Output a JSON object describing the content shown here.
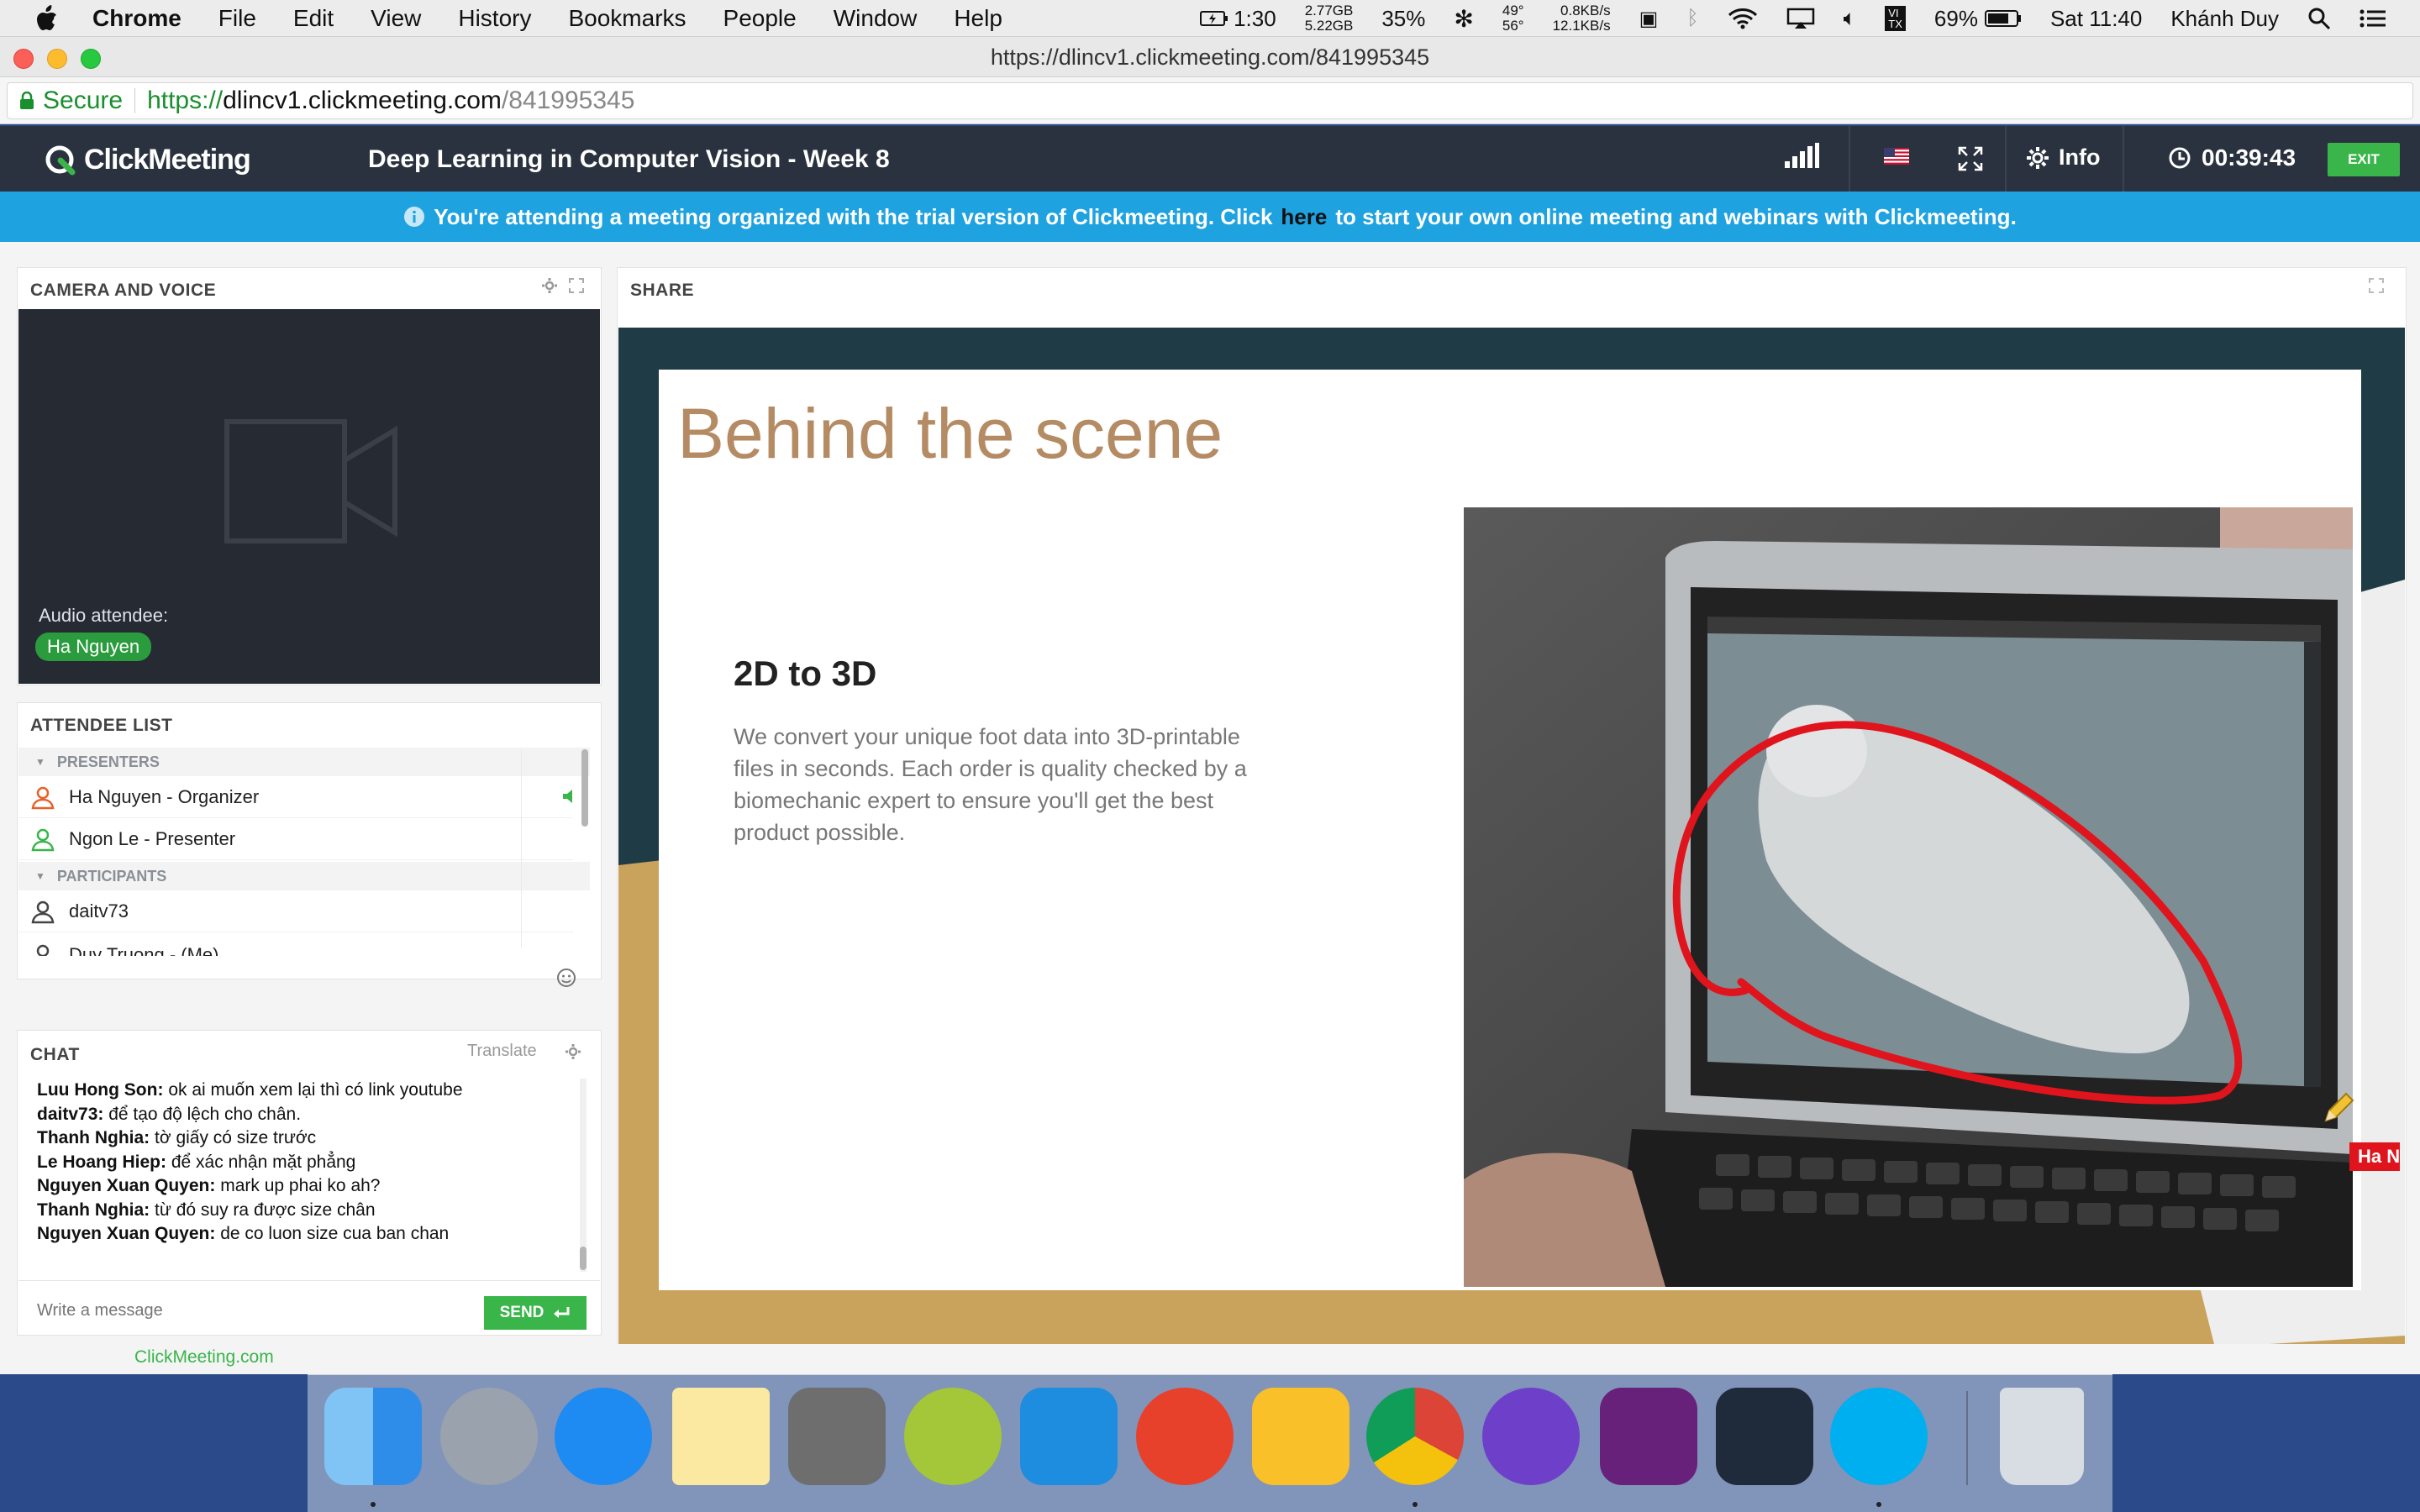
{
  "menubar": {
    "app": "Chrome",
    "items": [
      "File",
      "Edit",
      "View",
      "History",
      "Bookmarks",
      "People",
      "Window",
      "Help"
    ],
    "battery_time": "1:30",
    "mem_top": "2.77GB",
    "mem_bottom": "5.22GB",
    "cpu_pct": "35%",
    "temp_top": "49°",
    "temp_bottom": "56°",
    "net_up": "0.8KB/s",
    "net_down": "12.1KB/s",
    "battery": "69%",
    "clock": "Sat 11:40",
    "user": "Khánh Duy"
  },
  "browser": {
    "window_title": "https://dlincv1.clickmeeting.com/841995345",
    "secure_label": "Secure",
    "url_proto": "https://",
    "url_host": "dlincv1.clickmeeting.com",
    "url_path": "/841995345"
  },
  "header": {
    "logo": "ClickMeeting",
    "title": "Deep Learning in Computer Vision - Week 8",
    "info_label": "Info",
    "timer": "00:39:43",
    "exit_label": "EXIT"
  },
  "notice": {
    "before": "You're attending a meeting organized with the trial version of Clickmeeting. Click",
    "link": "here",
    "after": "to start your own online meeting and webinars with Clickmeeting."
  },
  "camera": {
    "title": "CAMERA AND VOICE",
    "audio_label": "Audio attendee:",
    "audio_name": "Ha Nguyen"
  },
  "attendees": {
    "title": "ATTENDEE LIST",
    "presenters_label": "PRESENTERS",
    "presenters": [
      {
        "name": "Ha Nguyen - Organizer"
      },
      {
        "name": "Ngon Le - Presenter"
      }
    ],
    "participants_label": "PARTICIPANTS",
    "participants": [
      {
        "name": "daitv73"
      },
      {
        "name": "Duy Truong - (Me)"
      }
    ]
  },
  "chat": {
    "title": "CHAT",
    "translate_label": "Translate",
    "messages": [
      {
        "author": "Luu Hong Son:",
        "text": "ok ai muốn xem lại thì có link youtube"
      },
      {
        "author": "daitv73:",
        "text": "để tạo độ lệch cho chân."
      },
      {
        "author": "Thanh Nghia:",
        "text": "tờ giấy có size trước"
      },
      {
        "author": "Le Hoang Hiep:",
        "text": "để xác nhận mặt phẳng"
      },
      {
        "author": "Nguyen Xuan Quyen:",
        "text": "mark up phai ko ah?"
      },
      {
        "author": "Thanh Nghia:",
        "text": "từ đó suy ra được size chân"
      },
      {
        "author": "Nguyen Xuan Quyen:",
        "text": "de co luon size cua ban chan"
      }
    ],
    "input_placeholder": "Write a message",
    "send_label": "SEND"
  },
  "share": {
    "title": "SHARE",
    "slide_title": "Behind the scene",
    "slide_subtitle": "2D to 3D",
    "slide_body": "We convert your unique foot data into 3D-printable files in seconds. Each order is quality checked by a biomechanic expert to ensure you'll get the best product possible.",
    "pointer_label": "Ha N"
  },
  "footer": {
    "link": "ClickMeeting.com"
  },
  "colors": {
    "accent_green": "#39b54a",
    "header_bg": "#2a323f",
    "notice_bg": "#1fa2e0",
    "slide_title": "#b58b64",
    "annotation_red": "#e0141c"
  },
  "dock": [
    "finder-icon",
    "launchpad-icon",
    "itunes-icon",
    "notes-icon",
    "system-preferences-icon",
    "android-studio-icon",
    "xcode-icon",
    "hat-app-icon",
    "sketch-icon",
    "chrome-icon",
    "github-desktop-icon",
    "visual-studio-icon",
    "vscode-icon",
    "skype-icon",
    "trash-icon"
  ]
}
